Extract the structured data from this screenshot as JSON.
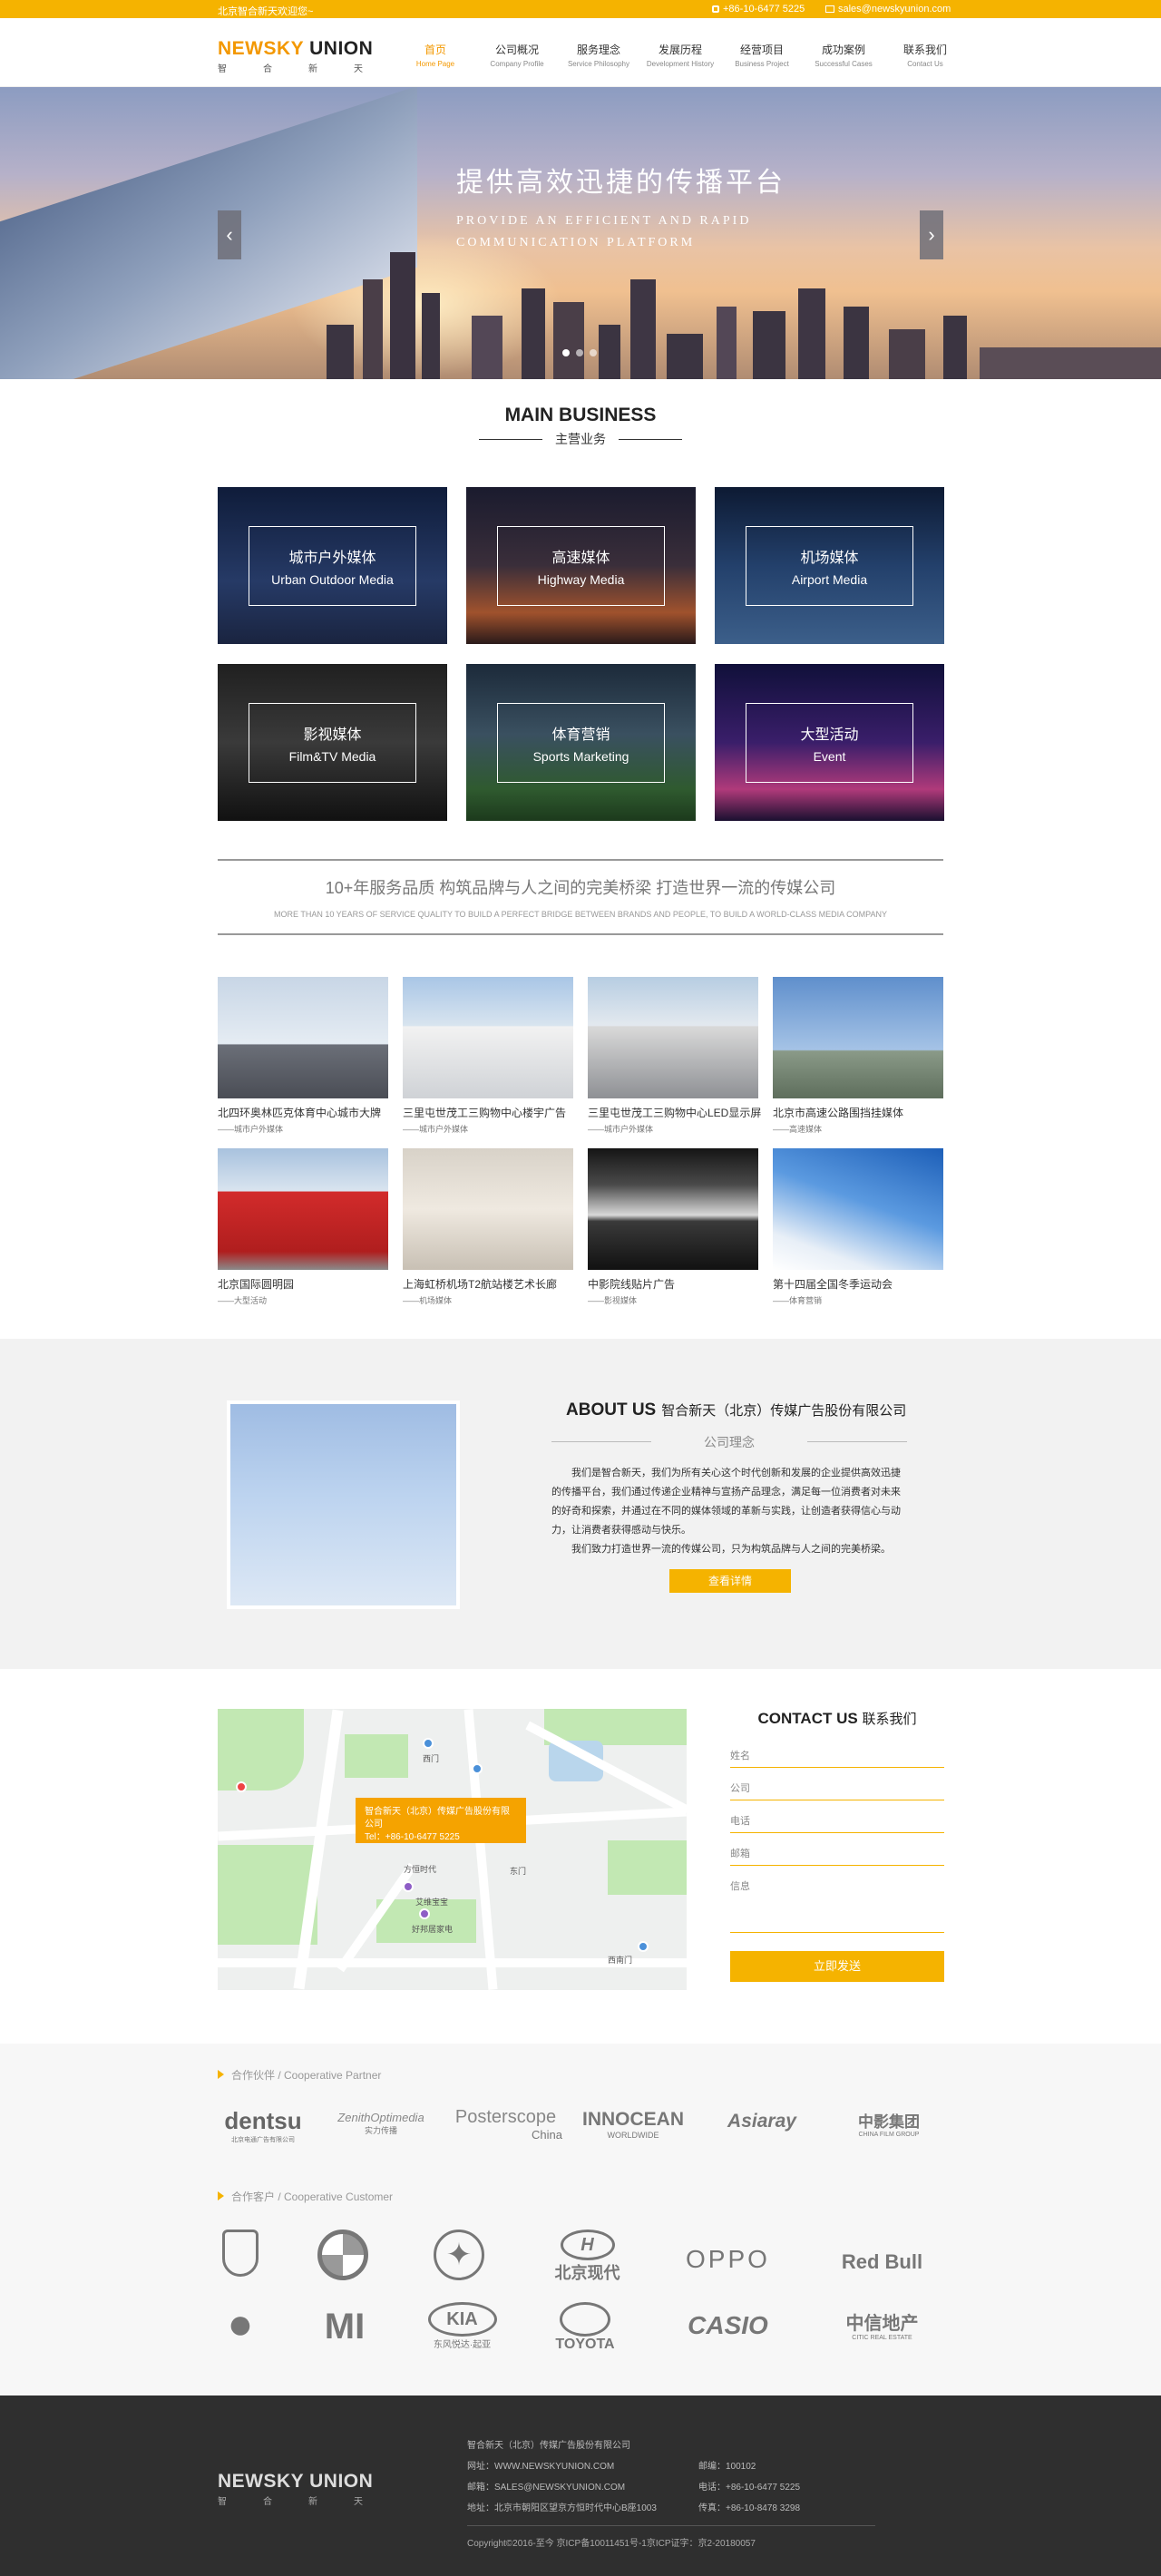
{
  "topbar": {
    "welcome": "北京智合新天欢迎您~",
    "phone": "+86-10-6477 5225",
    "email": "sales@newskyunion.com"
  },
  "brand": {
    "name_part1": "NEWSKY",
    "name_part2": "UNION",
    "cn": "智合新天"
  },
  "nav": [
    {
      "cn": "首页",
      "en": "Home Page"
    },
    {
      "cn": "公司概况",
      "en": "Company Profile"
    },
    {
      "cn": "服务理念",
      "en": "Service Philosophy"
    },
    {
      "cn": "发展历程",
      "en": "Development History"
    },
    {
      "cn": "经营项目",
      "en": "Business Project"
    },
    {
      "cn": "成功案例",
      "en": "Successful Cases"
    },
    {
      "cn": "联系我们",
      "en": "Contact Us"
    }
  ],
  "hero": {
    "title_cn": "提供高效迅捷的传播平台",
    "title_en_line1": "PROVIDE AN EFFICIENT AND RAPID",
    "title_en_line2": "COMMUNICATION PLATFORM",
    "prev": "‹",
    "next": "›"
  },
  "main_business": {
    "title_en": "MAIN BUSINESS",
    "title_cn": "主营业务",
    "items": [
      {
        "cn": "城市户外媒体",
        "en": "Urban Outdoor Media"
      },
      {
        "cn": "高速媒体",
        "en": "Highway Media"
      },
      {
        "cn": "机场媒体",
        "en": "Airport Media"
      },
      {
        "cn": "影视媒体",
        "en": "Film&TV Media"
      },
      {
        "cn": "体育营销",
        "en": "Sports Marketing"
      },
      {
        "cn": "大型活动",
        "en": "Event"
      }
    ]
  },
  "slogan": {
    "cn": "10+年服务品质  构筑品牌与人之间的完美桥梁  打造世界一流的传媒公司",
    "en": "MORE THAN 10 YEARS OF SERVICE QUALITY TO BUILD A PERFECT BRIDGE BETWEEN BRANDS AND PEOPLE, TO BUILD A WORLD-CLASS MEDIA COMPANY"
  },
  "cases": [
    {
      "title": "北四环奥林匹克体育中心城市大牌",
      "sub": "——城市户外媒体"
    },
    {
      "title": "三里屯世茂工三购物中心楼宇广告",
      "sub": "——城市户外媒体"
    },
    {
      "title": "三里屯世茂工三购物中心LED显示屏",
      "sub": "——城市户外媒体"
    },
    {
      "title": "北京市高速公路围挡挂媒体",
      "sub": "——高速媒体"
    },
    {
      "title": "北京国际圆明园",
      "sub": "——大型活动"
    },
    {
      "title": "上海虹桥机场T2航站楼艺术长廊",
      "sub": "——机场媒体"
    },
    {
      "title": "中影院线贴片广告",
      "sub": "——影视媒体"
    },
    {
      "title": "第十四届全国冬季运动会",
      "sub": "——体育营销"
    }
  ],
  "about": {
    "title_en": "ABOUT US",
    "title_cn": "智合新天（北京）传媒广告股份有限公司",
    "subtitle": "公司理念",
    "p1": "我们是智合新天，我们为所有关心这个时代创新和发展的企业提供高效迅捷的传播平台，我们通过传递企业精神与宣扬产品理念，满足每一位消费者对未来的好奇和探索，并通过在不同的媒体领域的革新与实践，让创造者获得信心与动力，让消费者获得感动与快乐。",
    "p2": "我们致力打造世界一流的传媒公司，只为构筑品牌与人之间的完美桥梁。",
    "more": "查看详情"
  },
  "map": {
    "popup_line1": "智合新天（北京）传媒广告股份有限公司",
    "popup_line2": "Tel：+86-10-6477 5225",
    "labels": [
      "西门",
      "东门",
      "方恒时代",
      "艾维宝宝",
      "好邦居家电",
      "西南门"
    ]
  },
  "contact": {
    "title_en": "CONTACT US",
    "title_cn": "联系我们",
    "fields": [
      "姓名",
      "公司",
      "电话",
      "邮箱"
    ],
    "message": "信息",
    "submit": "立即发送"
  },
  "partners": {
    "title": "合作伙伴 / Cooperative Partner",
    "logos": [
      "dentsu",
      "ZenithOptimedia",
      "Posterscope",
      "INNOCEAN",
      "Asiaray",
      "中影集团"
    ],
    "logo_subs": [
      "北京电通广告有限公司",
      "实力传播",
      "China",
      "WORLDWIDE",
      "",
      "CHINA FILM GROUP"
    ]
  },
  "customers": {
    "title": "合作客户 / Cooperative Customer",
    "logos": [
      "PORSCHE",
      "BMW",
      "Mercedes-Benz",
      "北京现代",
      "OPPO",
      "Red Bull",
      "Apple",
      "MI",
      "KIA",
      "TOYOTA",
      "CASIO",
      "中信地产"
    ],
    "logo_subs": [
      "",
      "",
      "",
      "",
      "",
      "",
      "",
      "",
      "东风悦达·起亚",
      "",
      "",
      "CITIC REAL ESTATE"
    ]
  },
  "footer": {
    "company": "智合新天（北京）传媒广告股份有限公司",
    "website": "网址：WWW.NEWSKYUNION.COM",
    "email": "邮箱：SALES@NEWSKYUNION.COM",
    "address": "地址：北京市朝阳区望京方恒时代中心B座1003",
    "postcode": "邮编：100102",
    "tel": "电话：+86-10-6477 5225",
    "fax": "传真：+86-10-8478 3298",
    "copyright": "Copyright©2016-至今 京ICP备10011451号-1京ICP证字：京2-20180057"
  },
  "colors": {
    "accent": "#f5b300",
    "footer_bg": "#2f2f2f",
    "about_bg": "#f2f2f2"
  }
}
